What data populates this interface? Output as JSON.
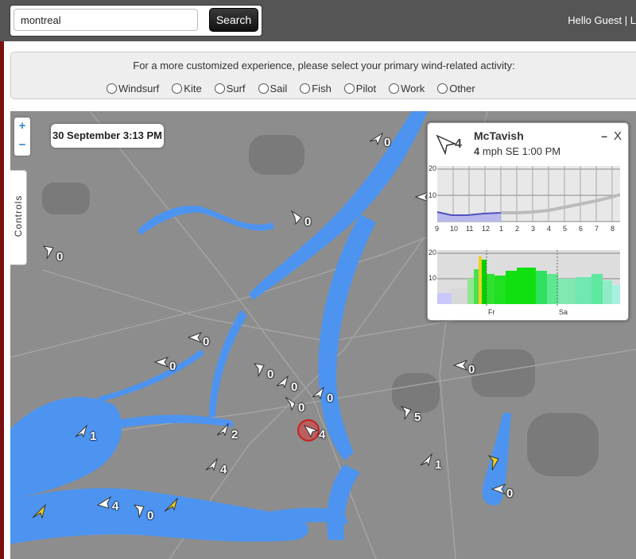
{
  "header": {
    "search_value": "montreal",
    "search_button": "Search",
    "greeting": "Hello Guest | L"
  },
  "activity": {
    "prompt": "For a more customized experience, please select your primary wind-related activity:",
    "options": [
      "Windsurf",
      "Kite",
      "Surf",
      "Sail",
      "Fish",
      "Pilot",
      "Work",
      "Other"
    ]
  },
  "map": {
    "zoom_in": "+",
    "zoom_out": "−",
    "controls_label": "Controls",
    "datetime": "30 September 3:13 PM",
    "stations": [
      "0",
      "0",
      "0",
      "0",
      "0",
      "0",
      "0",
      "0",
      "0",
      "0",
      "5",
      "1",
      "2",
      "4",
      "4",
      "0",
      "0",
      "4",
      "1",
      "0"
    ]
  },
  "popup": {
    "station_name": "McTavish",
    "speed": "4",
    "wind_detail": "mph SE 1:00 PM",
    "minimize": "–",
    "close": "X",
    "chart1_y_ticks": [
      "20",
      "10"
    ],
    "chart1_x_ticks": [
      "9",
      "10",
      "11",
      "12",
      "1",
      "2",
      "3",
      "4",
      "5",
      "6",
      "7",
      "8"
    ],
    "chart2_y_ticks": [
      "20",
      "10"
    ],
    "chart2_day_labels": [
      "Fr",
      "Sa"
    ]
  },
  "colors": {
    "water": "#4d94f0",
    "land": "#8d8d8d",
    "highlight": "#e03a3a",
    "calm_arrow": "#ffffff",
    "alert_arrow": "#f0d020"
  }
}
